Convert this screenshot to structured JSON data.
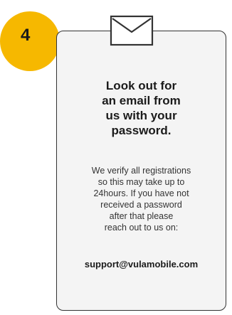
{
  "step": {
    "number": "4"
  },
  "card": {
    "icon": "envelope-icon",
    "title_lines": [
      "Look out for",
      "an email from",
      "us with your",
      "password."
    ],
    "body_lines": [
      "We verify all registrations",
      "so this may take up to",
      "24hours. If you have not",
      "received a password",
      "after that please",
      "reach out to us on:"
    ],
    "email": "support@vulamobile.com"
  },
  "colors": {
    "accent": "#f6b800",
    "card_background": "#f4f4f4",
    "border": "#333333",
    "text": "#1b1b1b"
  }
}
